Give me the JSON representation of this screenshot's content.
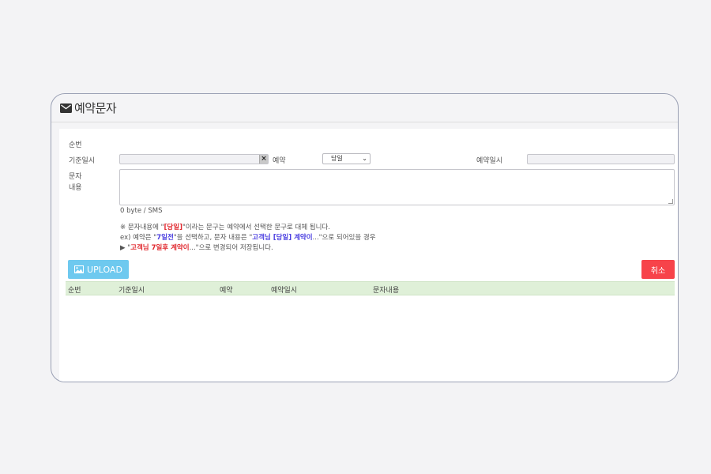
{
  "window": {
    "title": "예약문자",
    "icon": "mail-icon"
  },
  "form": {
    "seq_label": "순번",
    "base_date_label": "기준일시",
    "base_date_value": "",
    "base_date_clear": "×",
    "reservation_label": "예약",
    "reservation_selected": "당일",
    "reservation_date_label": "예약일시",
    "reservation_date_value": "",
    "content_label_1": "문자",
    "content_label_2": "내용",
    "content_value": "",
    "byte_info": "0 byte / SMS"
  },
  "notes": {
    "line1_a": "※ 문자내용에 \"",
    "line1_b": "[당일]",
    "line1_c": "\"이라는 문구는 예약에서 선택한 문구로 대체 됩니다.",
    "line2_a": "ex) 예약은 \"",
    "line2_b": "7일전",
    "line2_c": "\"을 선택하고, 문자 내용은 \"",
    "line2_d": "고객님 [당일] 계약이",
    "line2_e": "...\"으로 되어있을 경우",
    "line3_a": "▶ \"",
    "line3_b": "고객님 7일후 계약이",
    "line3_c": "...\"으로 변경되어 저장됩니다."
  },
  "buttons": {
    "upload": "UPLOAD",
    "cancel": "취소"
  },
  "table": {
    "columns": [
      "순번",
      "기준일시",
      "예약",
      "예약일시",
      "문자내용"
    ]
  },
  "colors": {
    "upload": "#6ec9ef",
    "cancel": "#f7434a",
    "table_header": "#dff0d8"
  }
}
